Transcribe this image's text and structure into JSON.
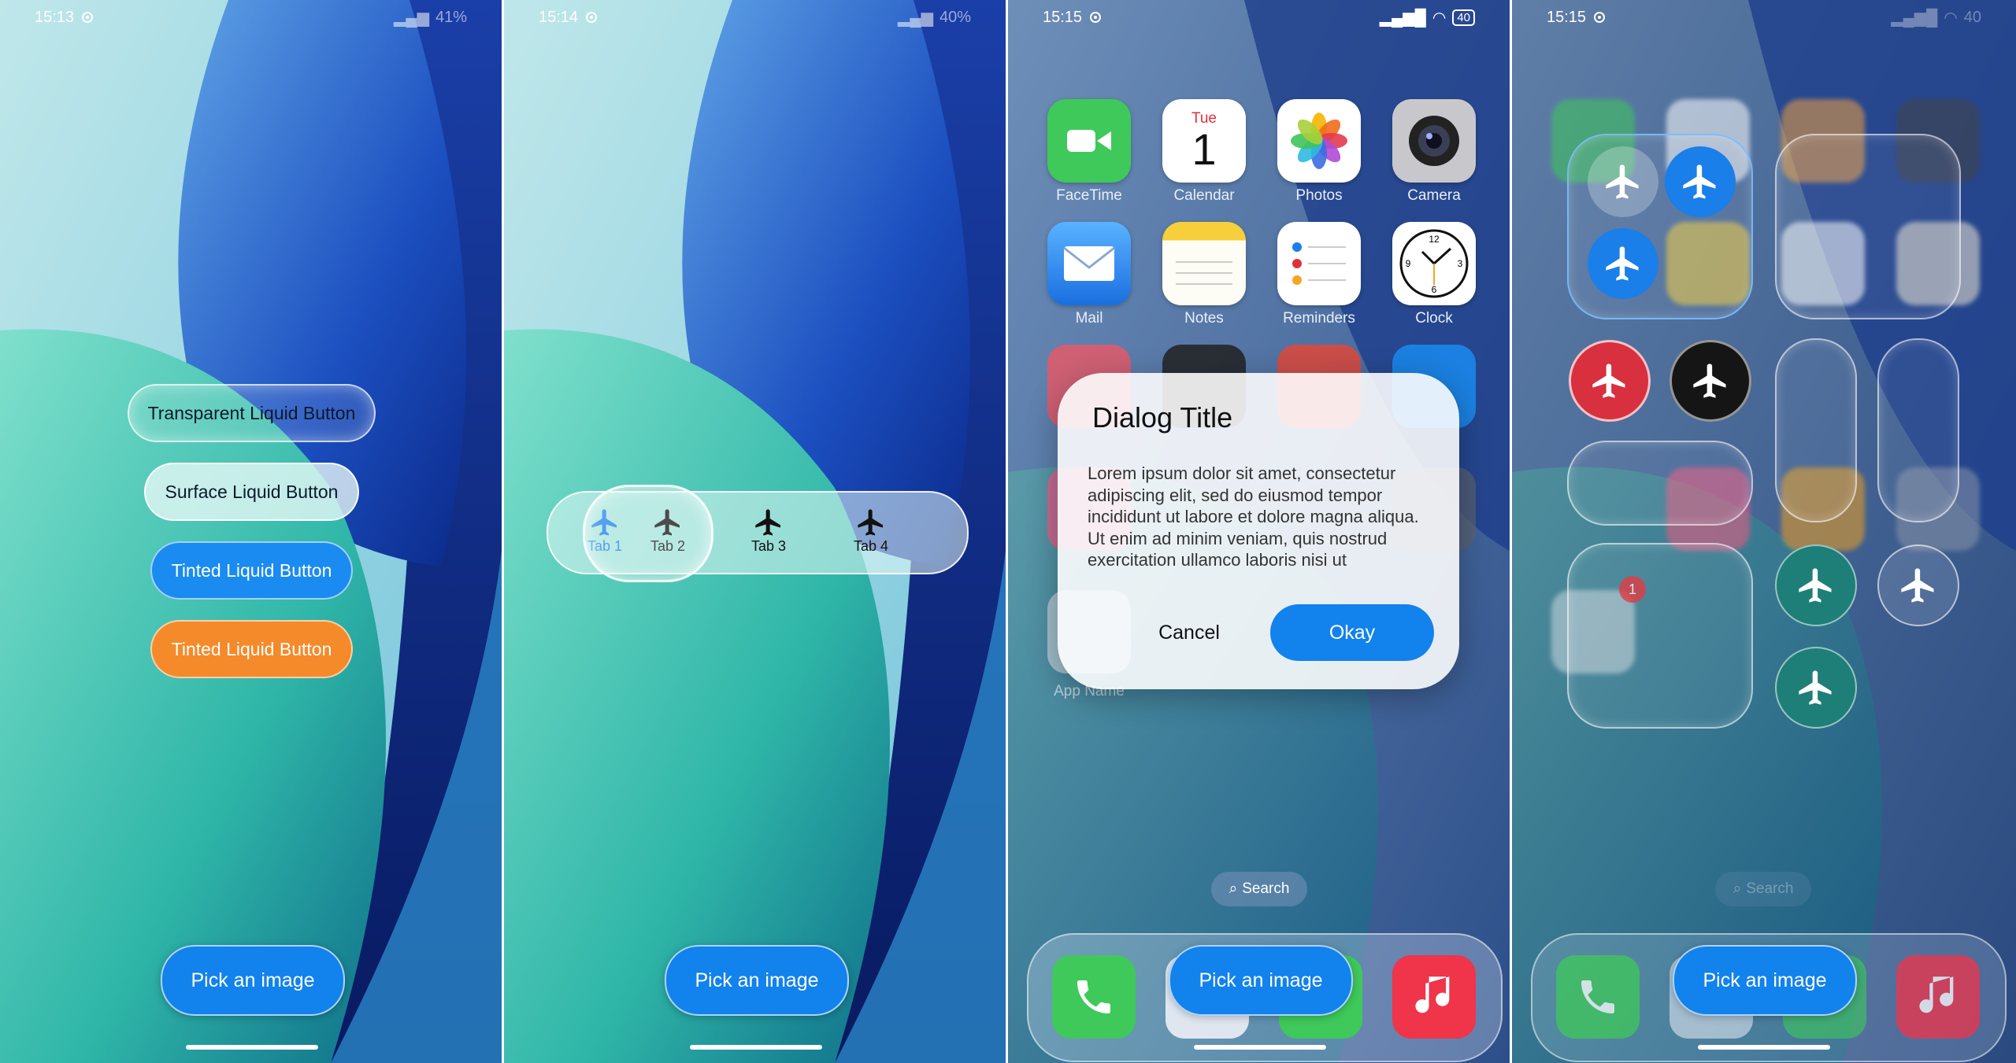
{
  "screens": [
    {
      "status": {
        "time": "15:13",
        "battery": "41%"
      },
      "buttons": {
        "transparent": "Transparent Liquid Button",
        "surface": "Surface Liquid Button",
        "tinted_blue": "Tinted Liquid Button",
        "tinted_orange": "Tinted Liquid Button"
      },
      "pick_image": "Pick an image"
    },
    {
      "status": {
        "time": "15:14",
        "battery": "40%"
      },
      "tabs": [
        {
          "label": "Tab 1",
          "icon": "airplane-icon"
        },
        {
          "label": "Tab 2",
          "icon": "airplane-icon"
        },
        {
          "label": "Tab 3",
          "icon": "airplane-icon"
        },
        {
          "label": "Tab 4",
          "icon": "airplane-icon"
        }
      ],
      "pick_image": "Pick an image"
    },
    {
      "status": {
        "time": "15:15",
        "battery": "40"
      },
      "apps": [
        {
          "label": "FaceTime"
        },
        {
          "label": "Calendar",
          "day": "Tue",
          "date": "1"
        },
        {
          "label": "Photos"
        },
        {
          "label": "Camera"
        },
        {
          "label": "Mail"
        },
        {
          "label": "Notes"
        },
        {
          "label": "Reminders"
        },
        {
          "label": "Clock"
        },
        {
          "label": "App Name"
        }
      ],
      "dialog": {
        "title": "Dialog Title",
        "body": "Lorem ipsum dolor sit amet, consectetur adipiscing elit, sed do eiusmod tempor incididunt ut labore et dolore magna aliqua. Ut enim ad minim veniam, quis nostrud exercitation ullamco laboris nisi ut",
        "cancel": "Cancel",
        "okay": "Okay"
      },
      "search": "Search",
      "pick_image": "Pick an image"
    },
    {
      "status": {
        "time": "15:15",
        "battery": "40"
      },
      "search": "Search",
      "badge": "1",
      "pick_image": "Pick an image"
    }
  ],
  "colors": {
    "accent_blue": "#1282ec",
    "orange": "#f58a2a",
    "teal": "#1e7f78",
    "red": "#e0303a"
  }
}
